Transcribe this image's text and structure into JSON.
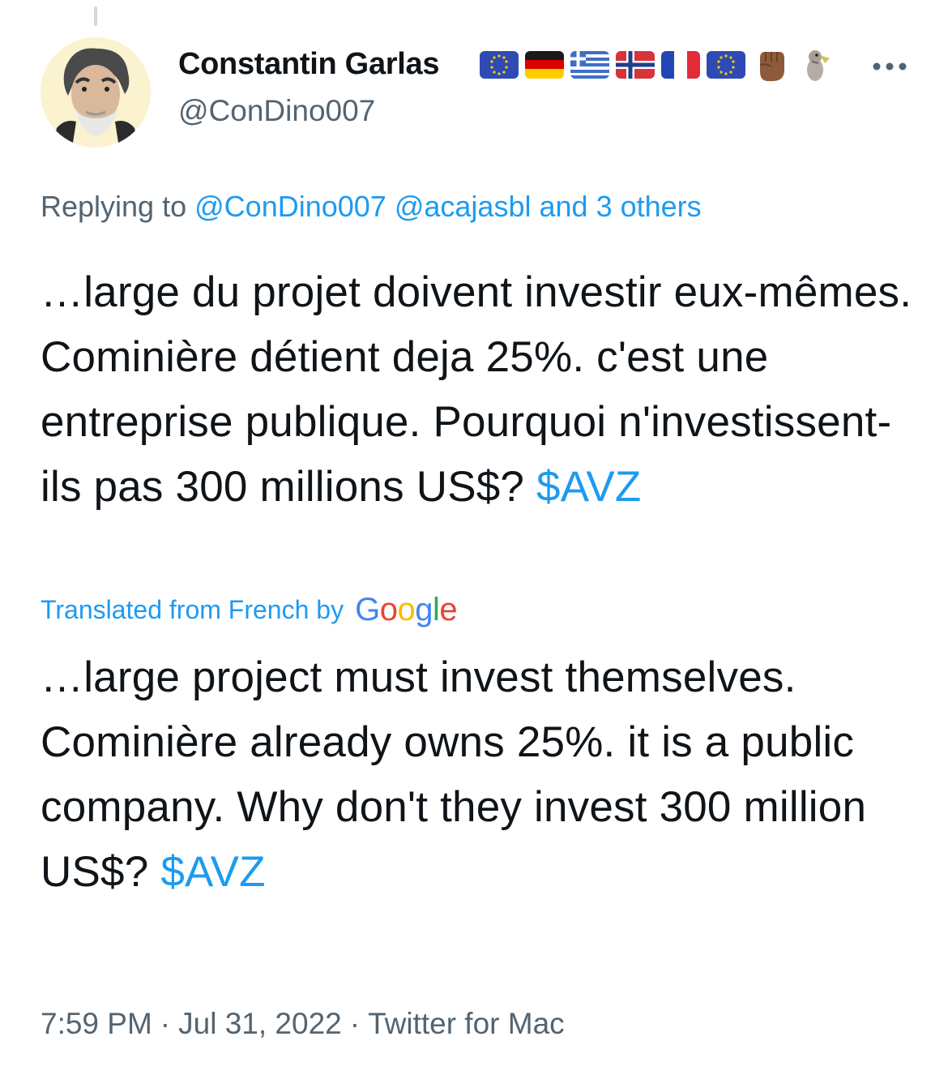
{
  "tweet": {
    "author_name": "Constantin Garlas",
    "author_handle": "@ConDino007",
    "name_emojis": [
      "eu-flag-icon",
      "germany-flag-icon",
      "greece-flag-icon",
      "norway-flag-icon",
      "france-flag-icon",
      "eu-flag-icon",
      "raised-fist-icon",
      "dodo-bird-icon"
    ],
    "replying_prefix": "Replying to",
    "replying_mentions": [
      "@ConDino007",
      "@acajasbl"
    ],
    "replying_and": "and",
    "replying_others": "3 others",
    "original_text": "…large du projet doivent investir eux-mêmes. Cominière détient deja 25%. c'est une entreprise publique. Pourquoi n'investissent-ils pas 300 millions US$?",
    "original_cashtag": "$AVZ",
    "translated_label": "Translated from French by",
    "translation_provider": "Google",
    "translated_text": "…large project must invest themselves. Cominière already owns 25%. it is a public company. Why don't they invest 300 million US$?",
    "translated_cashtag": "$AVZ",
    "time": "7:59 PM",
    "date": "Jul 31, 2022",
    "source": "Twitter for Mac",
    "separator": "·"
  },
  "colors": {
    "link": "#1d9bf0",
    "secondary_text": "#536471",
    "primary_text": "#0f1419"
  }
}
